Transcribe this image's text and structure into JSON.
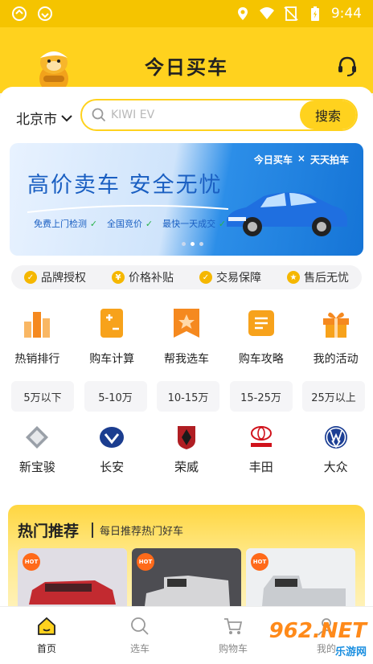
{
  "status": {
    "time": "9:44"
  },
  "header": {
    "title": "今日买车"
  },
  "location": {
    "city": "北京市"
  },
  "search": {
    "placeholder": "KIWI EV",
    "button": "搜索"
  },
  "banner": {
    "slogan": "高价卖车  安全无忧",
    "features": [
      "免费上门检测",
      "全国竞价",
      "最快一天成交"
    ],
    "brand_left": "今日买车",
    "brand_x": "×",
    "brand_right": "天天拍车"
  },
  "guarantees": [
    {
      "label": "品牌授权",
      "icon": "shield-icon"
    },
    {
      "label": "价格补贴",
      "icon": "yen-shield-icon"
    },
    {
      "label": "交易保障",
      "icon": "check-shield-icon"
    },
    {
      "label": "售后无忧",
      "icon": "badge-icon"
    }
  ],
  "quick": [
    {
      "label": "热销排行",
      "icon": "ranking-icon",
      "color": "#f5a23a"
    },
    {
      "label": "购车计算",
      "icon": "calculator-icon",
      "color": "#f7a21b"
    },
    {
      "label": "帮我选车",
      "icon": "star-bookmark-icon",
      "color": "#f5891f"
    },
    {
      "label": "购车攻略",
      "icon": "guide-icon",
      "color": "#f7a21b"
    },
    {
      "label": "我的活动",
      "icon": "gift-icon",
      "color": "#f7a21b"
    }
  ],
  "prices": [
    "5万以下",
    "5-10万",
    "10-15万",
    "15-25万",
    "25万以上"
  ],
  "brands": [
    {
      "label": "新宝骏",
      "icon": "baojun-logo-icon"
    },
    {
      "label": "长安",
      "icon": "changan-logo-icon"
    },
    {
      "label": "荣威",
      "icon": "roewe-logo-icon"
    },
    {
      "label": "丰田",
      "icon": "toyota-logo-icon"
    },
    {
      "label": "大众",
      "icon": "volkswagen-logo-icon"
    }
  ],
  "hot": {
    "title": "热门推荐",
    "subtitle": "每日推荐热门好车",
    "badge": "HOT"
  },
  "tabs": [
    {
      "label": "首页",
      "icon": "home-icon",
      "active": true
    },
    {
      "label": "选车",
      "icon": "search-car-icon",
      "active": false
    },
    {
      "label": "购物车",
      "icon": "cart-icon",
      "active": false
    },
    {
      "label": "我的",
      "icon": "profile-icon",
      "active": false
    }
  ],
  "watermark": {
    "main": "962.NET",
    "sub": "乐游网"
  },
  "colors": {
    "brand_yellow": "#ffd21e",
    "banner_blue": "#1a5fc2"
  }
}
